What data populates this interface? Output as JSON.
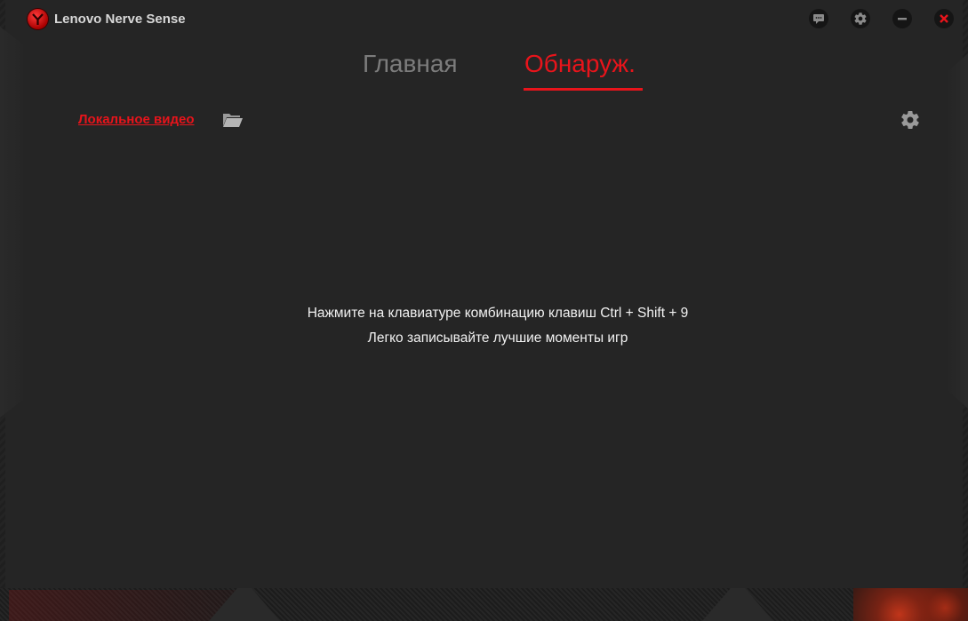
{
  "app": {
    "title": "Lenovo Nerve Sense"
  },
  "titlebar": {
    "buttons": [
      {
        "name": "feedback-icon"
      },
      {
        "name": "gear-icon"
      },
      {
        "name": "minimize-icon"
      },
      {
        "name": "close-icon"
      }
    ]
  },
  "tabs": [
    {
      "label": "Главная",
      "active": false
    },
    {
      "label": "Обнаруж.",
      "active": true
    }
  ],
  "toolbar": {
    "local_video_label": "Локальное видео",
    "folder_icon": "folder-open-icon",
    "settings_icon": "gear-icon"
  },
  "main": {
    "hint_line1": "Нажмите на клавиатуре комбинацию клавиш Ctrl + Shift + 9",
    "hint_line2": "Легко записывайте лучшие моменты игр"
  },
  "colors": {
    "accent": "#e8141b",
    "background": "#252525",
    "inactive_tab": "#7c7c7c",
    "text": "#f2f2f2"
  }
}
